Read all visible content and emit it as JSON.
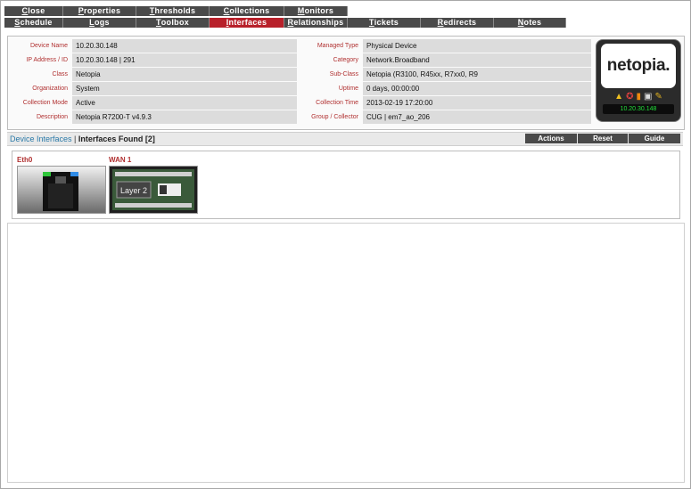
{
  "tabs_row1": [
    {
      "label": "Close",
      "underline": "C",
      "rest": "lose"
    },
    {
      "label": "Properties",
      "underline": "P",
      "rest": "roperties"
    },
    {
      "label": "Thresholds",
      "underline": "T",
      "rest": "hresholds"
    },
    {
      "label": "Collections",
      "underline": "C",
      "rest": "ollections"
    },
    {
      "label": "Monitors",
      "underline": "M",
      "rest": "onitors"
    }
  ],
  "tabs_row2": [
    {
      "label": "Schedule",
      "underline": "S",
      "rest": "chedule"
    },
    {
      "label": "Logs",
      "underline": "L",
      "rest": "ogs"
    },
    {
      "label": "Toolbox",
      "underline": "T",
      "rest": "oolbox"
    },
    {
      "label": "Interfaces",
      "underline": "I",
      "rest": "nterfaces",
      "active": true
    },
    {
      "label": "Relationships",
      "underline": "R",
      "rest": "elationships"
    },
    {
      "label": "Tickets",
      "underline": "T",
      "rest": "ickets"
    },
    {
      "label": "Redirects",
      "underline": "R",
      "rest": "edirects"
    },
    {
      "label": "Notes",
      "underline": "N",
      "rest": "otes"
    }
  ],
  "device_left": [
    {
      "label": "Device Name",
      "value": "10.20.30.148"
    },
    {
      "label": "IP Address / ID",
      "value": "10.20.30.148 | 291"
    },
    {
      "label": "Class",
      "value": "Netopia"
    },
    {
      "label": "Organization",
      "value": "System"
    },
    {
      "label": "Collection Mode",
      "value": "Active"
    },
    {
      "label": "Description",
      "value": "Netopia R7200-T v4.9.3"
    }
  ],
  "device_right": [
    {
      "label": "Managed Type",
      "value": "Physical Device"
    },
    {
      "label": "Category",
      "value": "Network.Broadband"
    },
    {
      "label": "Sub-Class",
      "value": "Netopia (R3100, R45xx, R7xx0, R9"
    },
    {
      "label": "Uptime",
      "value": "0 days, 00:00:00"
    },
    {
      "label": "Collection Time",
      "value": "2013-02-19 17:20:00"
    },
    {
      "label": "Group / Collector",
      "value": "CUG | em7_ao_206"
    }
  ],
  "device_card": {
    "logo_text": "netopia.",
    "ip": "10.20.30.148",
    "icons": [
      "warning-icon",
      "lifebuoy-icon",
      "signal-bars-icon",
      "printer-icon",
      "wrench-icon"
    ]
  },
  "interfaces_bar": {
    "link": "Device Interfaces",
    "separator": " | ",
    "found": "Interfaces Found [2]",
    "buttons": [
      "Actions",
      "Reset",
      "Guide"
    ]
  },
  "interfaces": [
    {
      "name": "Eth0",
      "thumb": "ethernet-port"
    },
    {
      "name": "WAN 1",
      "thumb": "layer2-circuit-board",
      "thumb_text": "Layer 2"
    }
  ],
  "colors": {
    "tab_bg": "#4a4a4a",
    "tab_active": "#b8202a",
    "label_red": "#b03030",
    "link_blue": "#2b7aa8",
    "ip_green": "#22e03a"
  }
}
